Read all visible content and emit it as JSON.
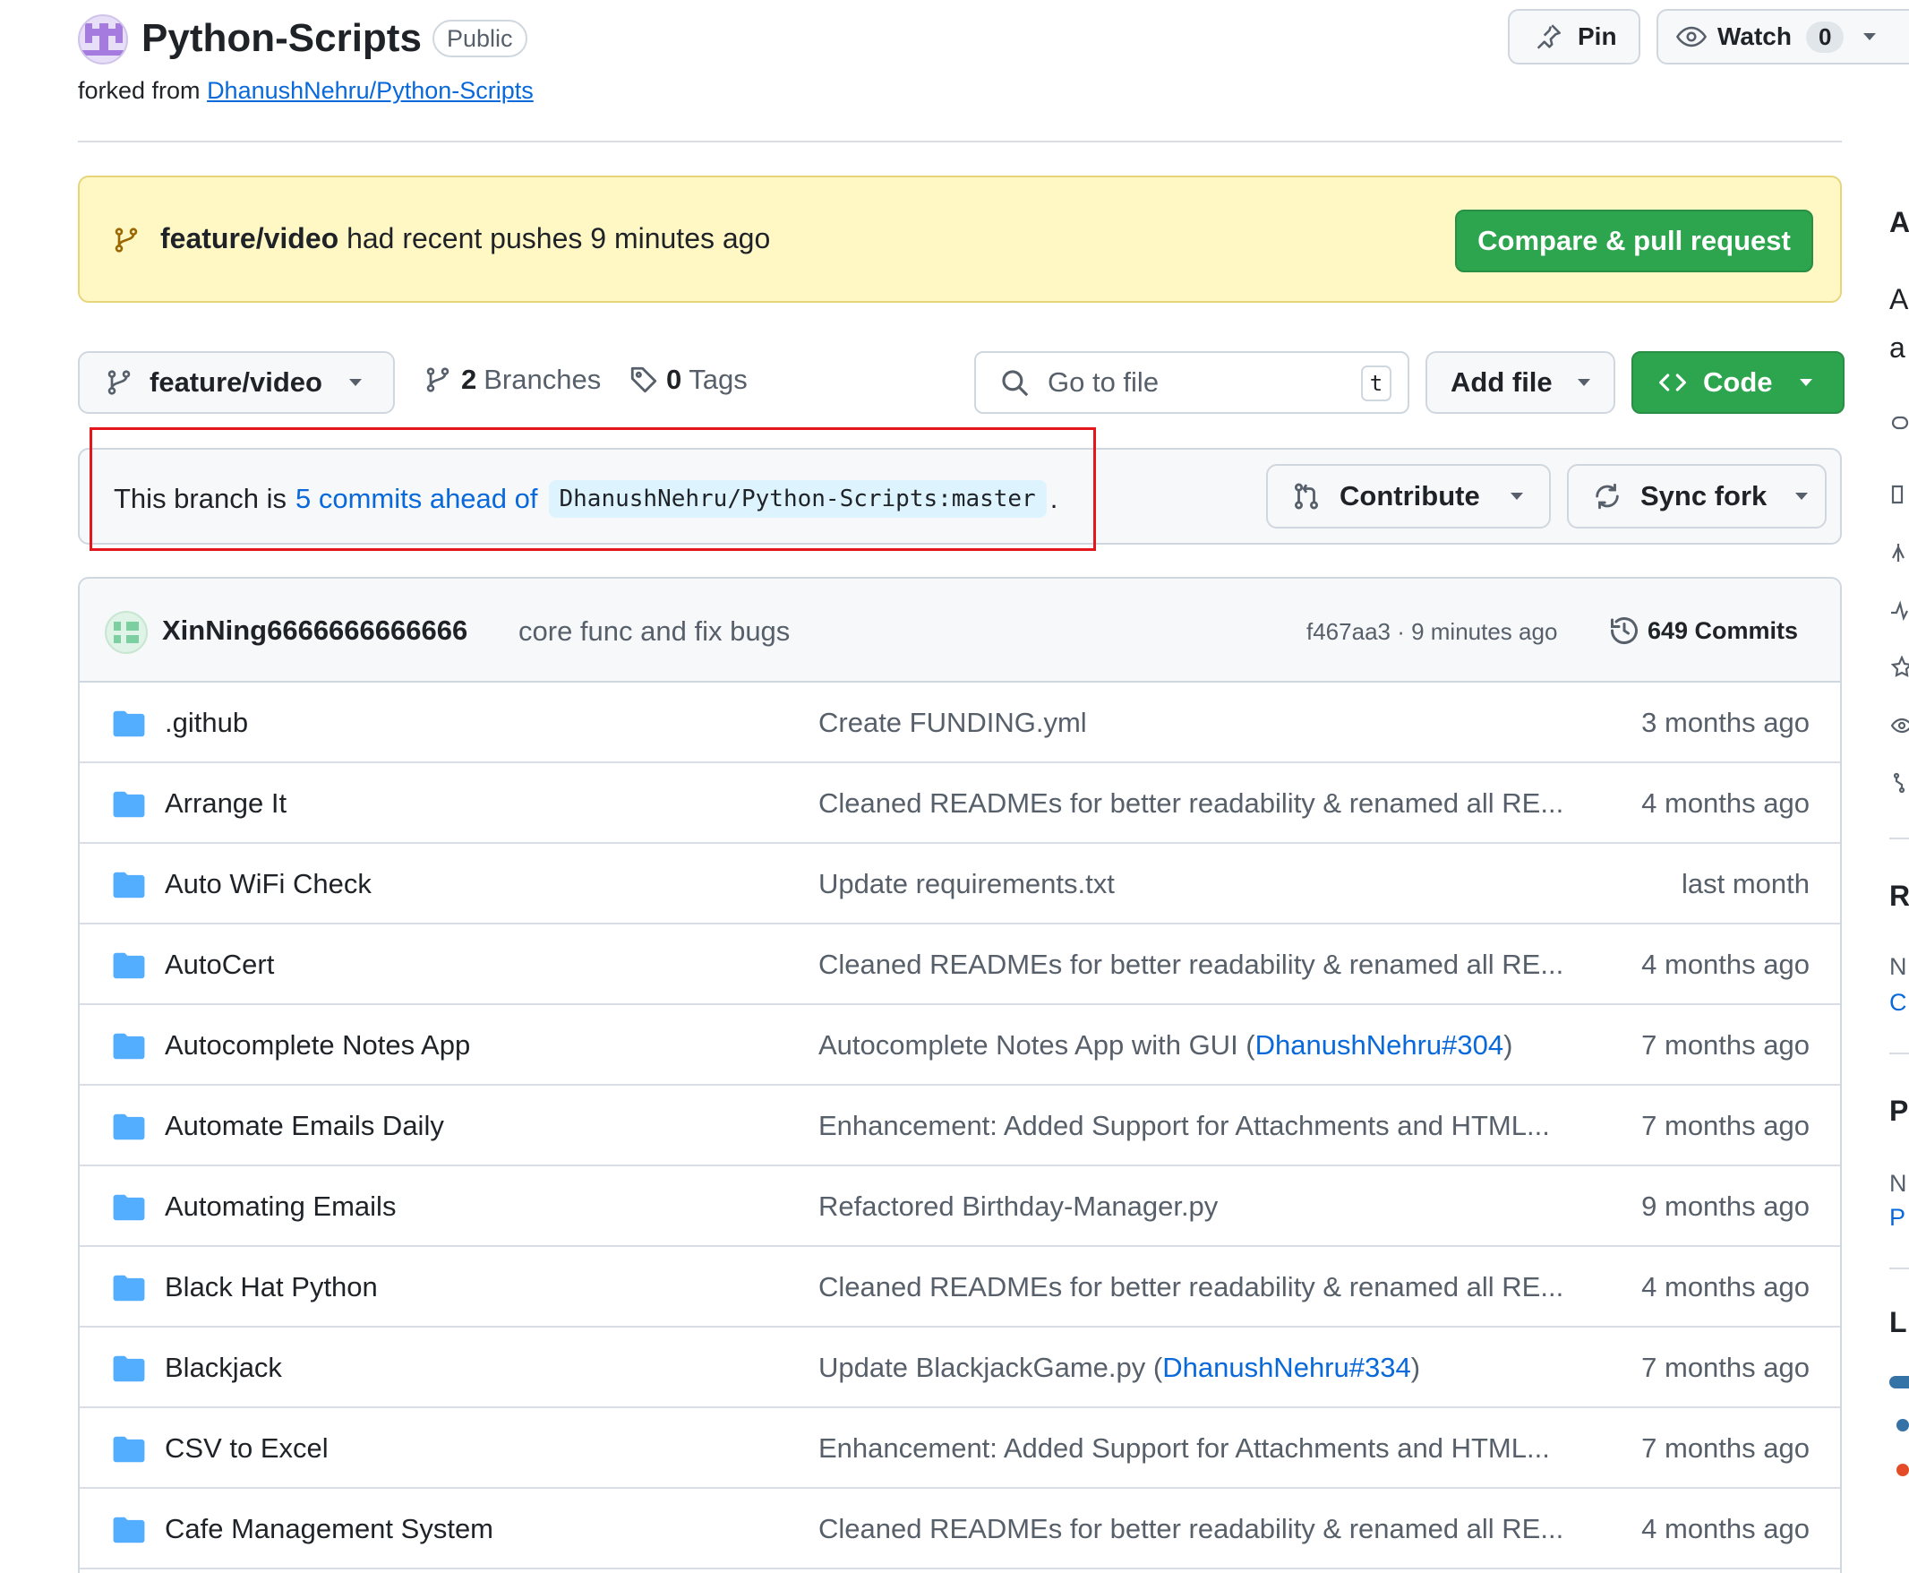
{
  "repo": {
    "name": "Python-Scripts",
    "visibility": "Public",
    "forked_prefix": "forked from",
    "forked_from": "DhanushNehru/Python-Scripts"
  },
  "header_actions": {
    "pin_label": "Pin",
    "watch_label": "Watch",
    "watch_count": "0"
  },
  "banner": {
    "branch": "feature/video",
    "text": "had recent pushes 9 minutes ago",
    "button_label": "Compare & pull request"
  },
  "toolbar": {
    "branch_selected": "feature/video",
    "branches_count": "2",
    "branches_label": "Branches",
    "tags_count": "0",
    "tags_label": "Tags",
    "goto_placeholder": "Go to file",
    "goto_shortcut": "t",
    "add_file_label": "Add file",
    "code_label": "Code"
  },
  "ahead": {
    "prefix": "This branch is",
    "link": "5 commits ahead of",
    "target": "DhanushNehru/Python-Scripts:master",
    "suffix": ".",
    "contribute_label": "Contribute",
    "sync_label": "Sync fork"
  },
  "latest_commit": {
    "user": "XinNing6666666666666",
    "message": "core func and fix bugs",
    "sha_time": "f467aa3 · 9 minutes ago",
    "commits_label": "649 Commits"
  },
  "files": [
    {
      "name": ".github",
      "msg": "Create FUNDING.yml",
      "msg_link": "",
      "msg_tail": "",
      "date": "3 months ago"
    },
    {
      "name": "Arrange It",
      "msg": "Cleaned READMEs for better readability & renamed all RE...",
      "msg_link": "",
      "msg_tail": "",
      "date": "4 months ago"
    },
    {
      "name": "Auto WiFi Check",
      "msg": "Update requirements.txt",
      "msg_link": "",
      "msg_tail": "",
      "date": "last month"
    },
    {
      "name": "AutoCert",
      "msg": "Cleaned READMEs for better readability & renamed all RE...",
      "msg_link": "",
      "msg_tail": "",
      "date": "4 months ago"
    },
    {
      "name": "Autocomplete Notes App",
      "msg": "Autocomplete Notes App with GUI (",
      "msg_link": "DhanushNehru#304",
      "msg_tail": ")",
      "date": "7 months ago"
    },
    {
      "name": "Automate Emails Daily",
      "msg": "Enhancement: Added Support for Attachments and HTML...",
      "msg_link": "",
      "msg_tail": "",
      "date": "7 months ago"
    },
    {
      "name": "Automating Emails",
      "msg": "Refactored Birthday-Manager.py",
      "msg_link": "",
      "msg_tail": "",
      "date": "9 months ago"
    },
    {
      "name": "Black Hat Python",
      "msg": "Cleaned READMEs for better readability & renamed all RE...",
      "msg_link": "",
      "msg_tail": "",
      "date": "4 months ago"
    },
    {
      "name": "Blackjack",
      "msg": "Update BlackjackGame.py (",
      "msg_link": "DhanushNehru#334",
      "msg_tail": ")",
      "date": "7 months ago"
    },
    {
      "name": "CSV to Excel",
      "msg": "Enhancement: Added Support for Attachments and HTML...",
      "msg_link": "",
      "msg_tail": "",
      "date": "7 months ago"
    },
    {
      "name": "Cafe Management System",
      "msg": "Cleaned READMEs for better readability & renamed all RE...",
      "msg_link": "",
      "msg_tail": "",
      "date": "4 months ago"
    }
  ],
  "sidebar_fragments": {
    "about_heading": "A",
    "about_line1": "A",
    "about_line2": "a",
    "releases_heading": "R",
    "releases_line": "N",
    "releases_link": "C",
    "packages_heading": "P",
    "packages_line": "N",
    "packages_link": "P",
    "languages_heading": "L"
  },
  "colors": {
    "accent_green": "#2da44e",
    "link_blue": "#0969da",
    "banner_yellow": "#fff8c5",
    "highlight_red": "#e3161b",
    "folder_blue": "#54aeff"
  }
}
